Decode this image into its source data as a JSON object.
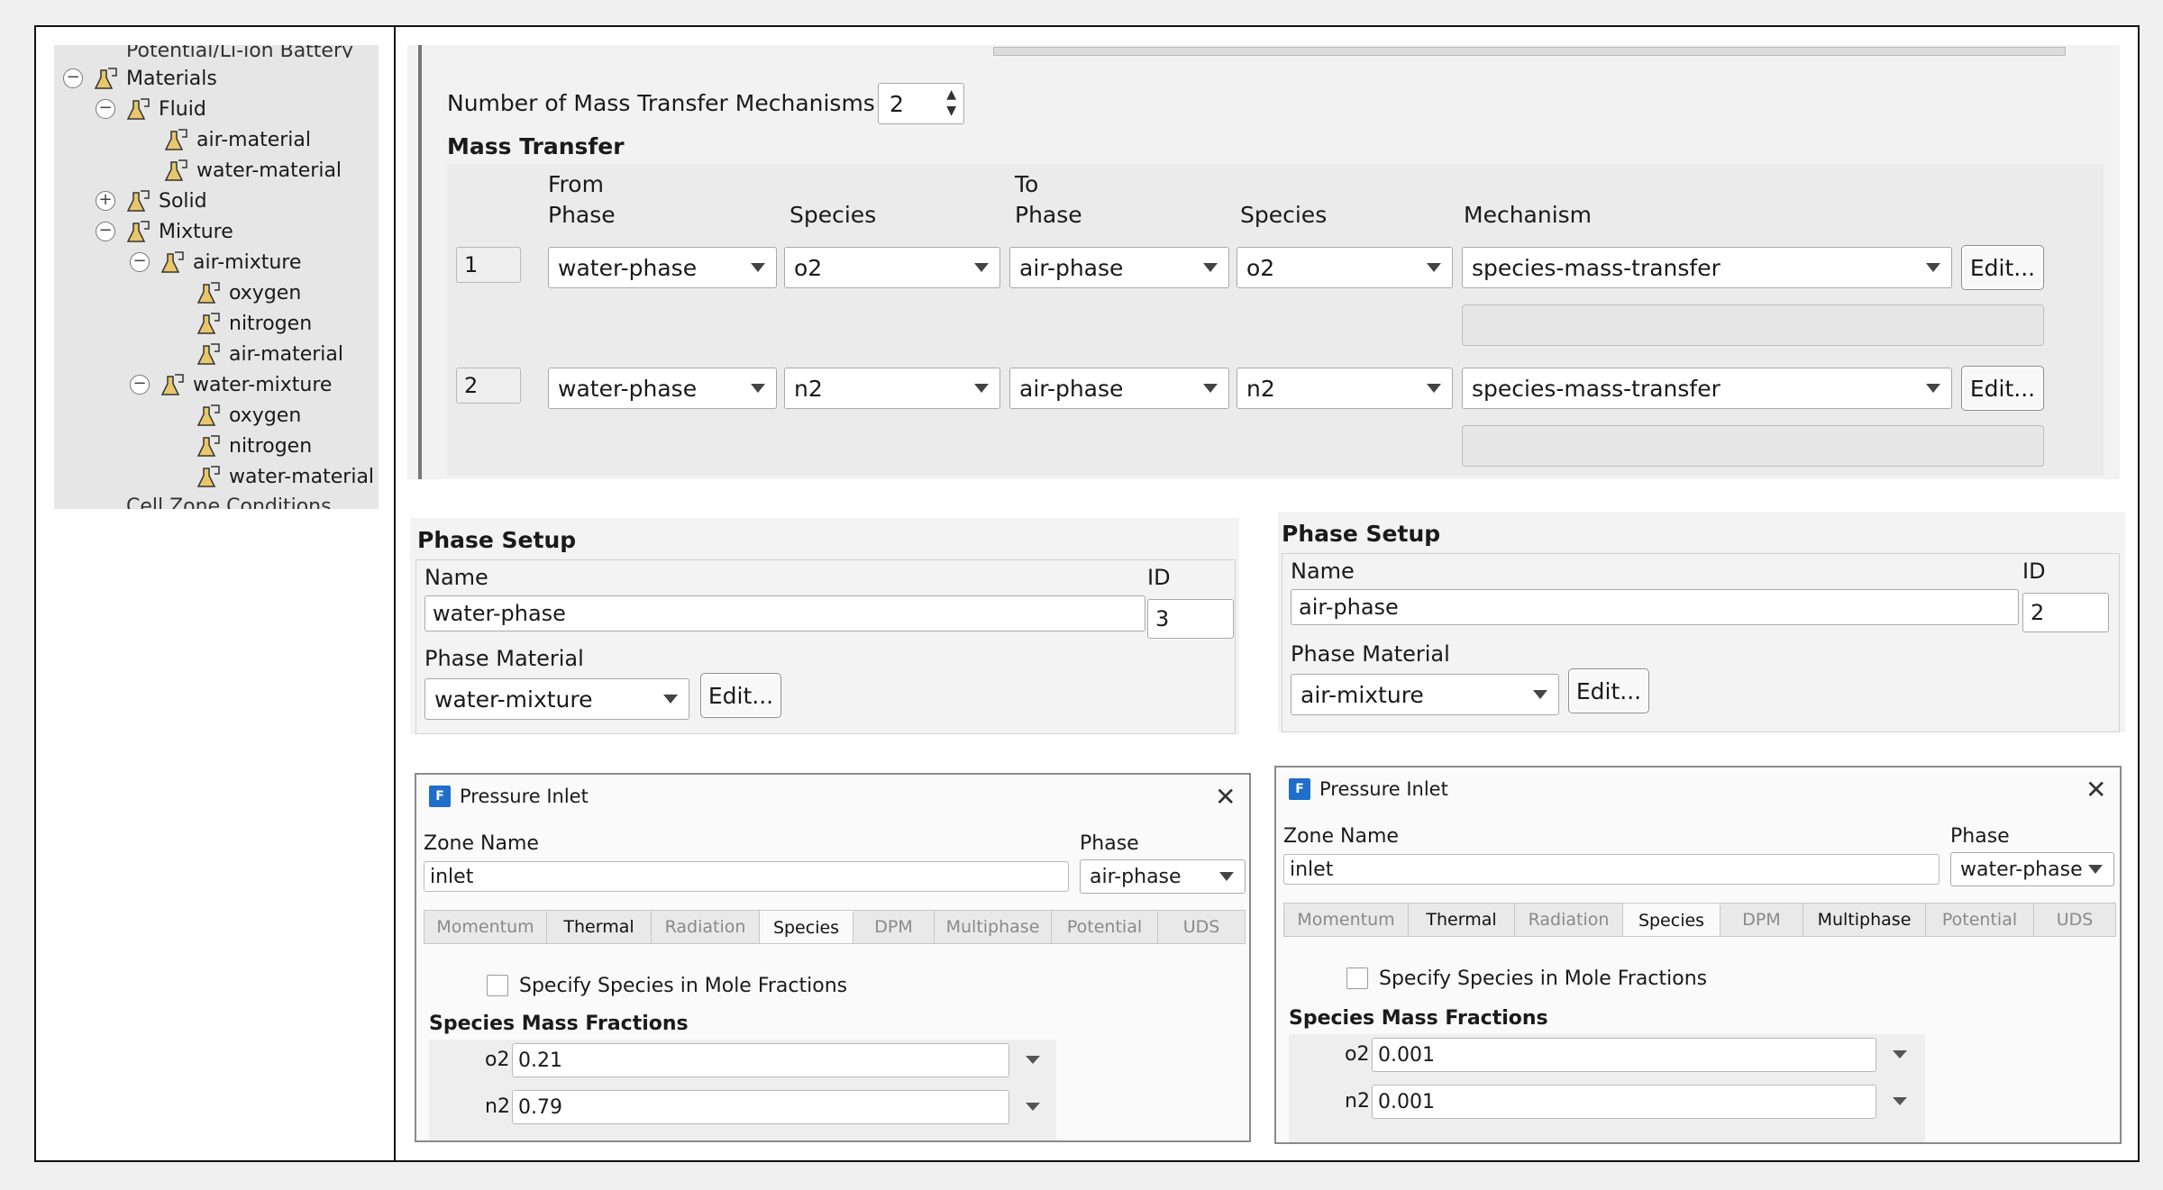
{
  "tree": {
    "items": [
      {
        "label": "Materials",
        "toggle": "−",
        "level": 0
      },
      {
        "label": "Fluid",
        "toggle": "−",
        "level": 1
      },
      {
        "label": "air-material",
        "toggle": "",
        "level": 2
      },
      {
        "label": "water-material",
        "toggle": "",
        "level": 2
      },
      {
        "label": "Solid",
        "toggle": "+",
        "level": 1
      },
      {
        "label": "Mixture",
        "toggle": "−",
        "level": 1
      },
      {
        "label": "air-mixture",
        "toggle": "−",
        "level": 2
      },
      {
        "label": "oxygen",
        "toggle": "",
        "level": 3
      },
      {
        "label": "nitrogen",
        "toggle": "",
        "level": 3
      },
      {
        "label": "air-material",
        "toggle": "",
        "level": 3
      },
      {
        "label": "water-mixture",
        "toggle": "−",
        "level": 2
      },
      {
        "label": "oxygen",
        "toggle": "",
        "level": 3
      },
      {
        "label": "nitrogen",
        "toggle": "",
        "level": 3
      },
      {
        "label": "water-material",
        "toggle": "",
        "level": 3
      }
    ],
    "top_cut_label": "Potential/Li-ion Battery",
    "bottom_cut_label": "Cell Zone Conditions"
  },
  "mass_transfer": {
    "mechanisms_label": "Number of Mass Transfer Mechanisms",
    "mechanisms_value": "2",
    "section_title": "Mass Transfer",
    "headers": {
      "from": "From",
      "from_phase": "Phase",
      "from_species": "Species",
      "to": "To",
      "to_phase": "Phase",
      "to_species": "Species",
      "mechanism": "Mechanism"
    },
    "rows": [
      {
        "id": "1",
        "from_phase": "water-phase",
        "from_species": "o2",
        "to_phase": "air-phase",
        "to_species": "o2",
        "mechanism": "species-mass-transfer",
        "edit": "Edit..."
      },
      {
        "id": "2",
        "from_phase": "water-phase",
        "from_species": "n2",
        "to_phase": "air-phase",
        "to_species": "n2",
        "mechanism": "species-mass-transfer",
        "edit": "Edit..."
      }
    ]
  },
  "phase_left": {
    "title": "Phase Setup",
    "name_label": "Name",
    "name_value": "water-phase",
    "id_label": "ID",
    "id_value": "3",
    "material_label": "Phase Material",
    "material_value": "water-mixture",
    "edit": "Edit..."
  },
  "phase_right": {
    "title": "Phase Setup",
    "name_label": "Name",
    "name_value": "air-phase",
    "id_label": "ID",
    "id_value": "2",
    "material_label": "Phase Material",
    "material_value": "air-mixture",
    "edit": "Edit..."
  },
  "inlet_left": {
    "title": "Pressure Inlet",
    "icon_letter": "F",
    "zone_label": "Zone Name",
    "zone_value": "inlet",
    "phase_label": "Phase",
    "phase_value": "air-phase",
    "tabs": [
      "Momentum",
      "Thermal",
      "Radiation",
      "Species",
      "DPM",
      "Multiphase",
      "Potential",
      "UDS"
    ],
    "active_tab": "Species",
    "checkbox_label": "Specify Species in Mole Fractions",
    "fractions_title": "Species Mass Fractions",
    "fractions": [
      {
        "species": "o2",
        "value": "0.21"
      },
      {
        "species": "n2",
        "value": "0.79"
      }
    ]
  },
  "inlet_right": {
    "title": "Pressure Inlet",
    "icon_letter": "F",
    "zone_label": "Zone Name",
    "zone_value": "inlet",
    "phase_label": "Phase",
    "phase_value": "water-phase",
    "tabs": [
      "Momentum",
      "Thermal",
      "Radiation",
      "Species",
      "DPM",
      "Multiphase",
      "Potential",
      "UDS"
    ],
    "active_tab": "Species",
    "checkbox_label": "Specify Species in Mole Fractions",
    "fractions_title": "Species Mass Fractions",
    "fractions": [
      {
        "species": "o2",
        "value": "0.001"
      },
      {
        "species": "n2",
        "value": "0.001"
      }
    ]
  },
  "colors": {
    "panel_bg": "#f2f2f2",
    "tree_bg": "#e6e6e6",
    "icon_blue": "#1f6ec9",
    "border": "#111111"
  }
}
